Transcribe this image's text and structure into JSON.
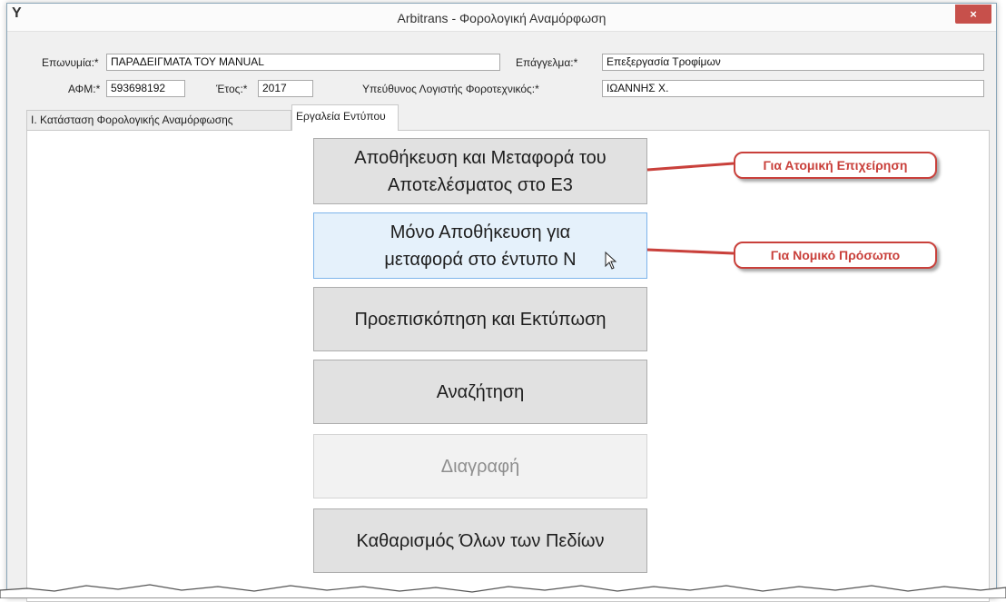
{
  "window": {
    "title": "Arbitrans - Φορολογική Αναμόρφωση",
    "close_glyph": "×",
    "app_icon": "Y"
  },
  "form": {
    "eponymia_label": "Επωνυμία:*",
    "eponymia_value": "ΠΑΡΑΔΕΙΓΜΑΤΑ ΤΟΥ MANUAL",
    "epaggelma_label": "Επάγγελμα:*",
    "epaggelma_value": "Επεξεργασία Τροφίμων",
    "afm_label": "ΑΦΜ:*",
    "afm_value": "593698192",
    "etos_label": "Έτος:*",
    "etos_value": "2017",
    "logistis_label": "Υπεύθυνος Λογιστής Φοροτεχνικός:*",
    "logistis_value": "ΙΩΑΝΝΗΣ Χ."
  },
  "tabs": [
    {
      "label": "Ι. Κατάσταση Φορολογικής Αναμόρφωσης",
      "active": false
    },
    {
      "label": "Εργαλεία Εντύπου",
      "active": true
    }
  ],
  "buttons": {
    "save_transfer_e3": [
      "Αποθήκευση και Μεταφορά του",
      "Αποτελέσματος στο Ε3"
    ],
    "save_only_n": [
      "Μόνο Αποθήκευση για",
      "μεταφορά στο έντυπο Ν"
    ],
    "preview_print": "Προεπισκόπηση και Εκτύπωση",
    "search": "Αναζήτηση",
    "delete": "Διαγραφή",
    "clear_all": "Καθαρισμός Όλων των Πεδίων"
  },
  "callouts": {
    "individual": "Για Ατομική Επιχείρηση",
    "legal_entity": "Για Νομικό Πρόσωπο"
  },
  "colors": {
    "callout_red": "#c9403b",
    "hover_bg": "#e5f1fb",
    "close_red": "#c7504b"
  },
  "icons": [
    "app-logo-icon",
    "close-icon",
    "mouse-cursor-icon"
  ]
}
